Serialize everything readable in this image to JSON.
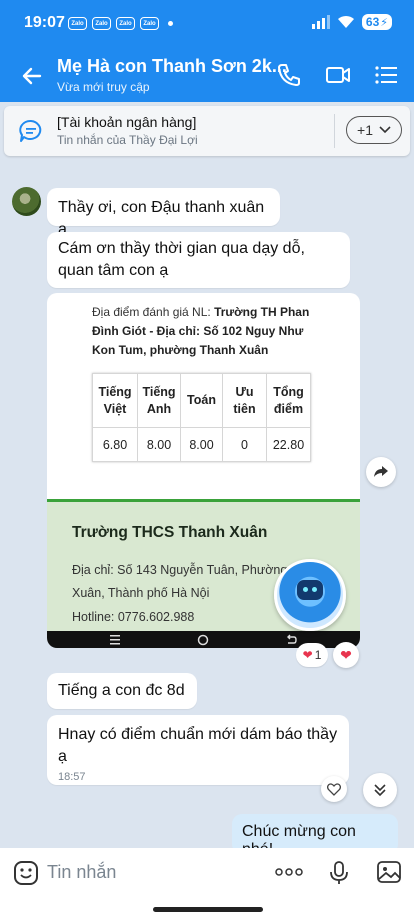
{
  "status_bar": {
    "time": "19:07",
    "app_badges": [
      "Zalo",
      "Zalo",
      "Zalo",
      "Zalo"
    ],
    "battery_level": "63"
  },
  "header": {
    "title": "Mẹ Hà con Thanh Sơn 2k...",
    "subtitle": "Vừa mới truy cập"
  },
  "pinned": {
    "title": "[Tài khoản ngân hàng]",
    "subtitle": "Tin nhắn của Thầy Đại Lợi",
    "more_count": "+1"
  },
  "messages": {
    "m1": "Thầy ơi, con Đậu thanh xuân ạ",
    "m2": "Cám ơn thầy thời gian qua dạy dỗ, quan tâm con ạ",
    "m3": "Tiếng a con đc 8d",
    "m4": "Hnay có điểm chuẩn mới dám báo thầy ạ",
    "m4_time": "18:57",
    "mine": "Chúc mừng con nhé!"
  },
  "card": {
    "doc_label": "Địa điểm đánh giá NL: ",
    "doc_bold": "Trường TH Phan Đình Giót - Địa chỉ: Số 102 Nguy Như Kon Tum, phường Thanh Xuân",
    "table": {
      "headers": [
        "Tiếng Việt",
        "Tiếng Anh",
        "Toán",
        "Ưu tiên",
        "Tổng điểm"
      ],
      "row": [
        "6.80",
        "8.00",
        "8.00",
        "0",
        "22.80"
      ]
    },
    "school_name": "Trường THCS Thanh Xuân",
    "school_address_1": "Địa chỉ: Số 143 Nguyễn Tuân, Phường",
    "school_address_2": "Xuân, Thành phố Hà Nội",
    "school_hotline": "Hotline: 0776.602.988"
  },
  "reactions": {
    "card_heart_count": "1"
  },
  "composer": {
    "placeholder": "Tin nhắn"
  },
  "colors": {
    "brand_blue": "#1f8af0",
    "chat_bg": "#dbe4ef",
    "my_bubble": "#d6ebfb",
    "heart": "#e8344e"
  }
}
